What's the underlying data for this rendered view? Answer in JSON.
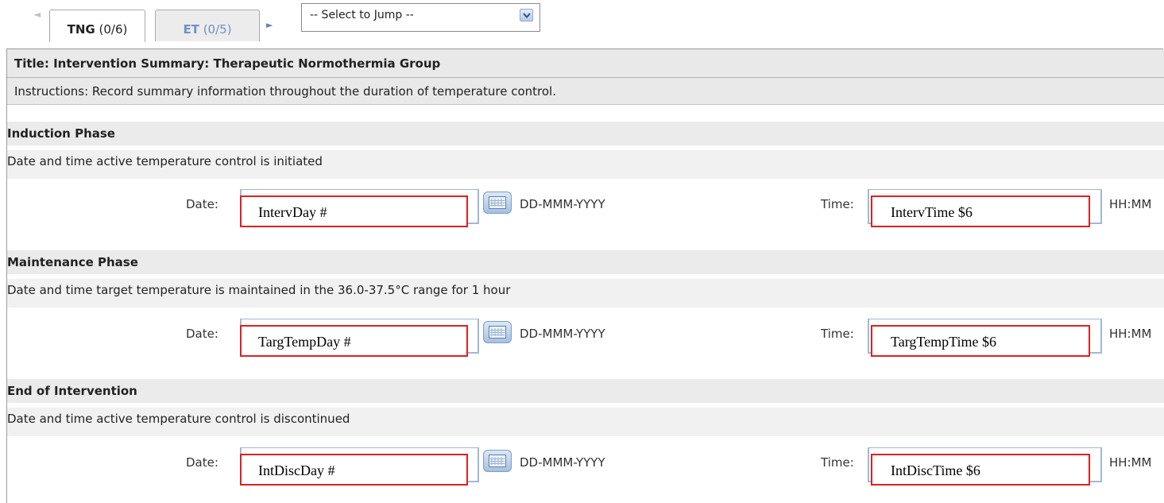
{
  "tabs": {
    "prev_arrow": "◄",
    "next_arrow": "►",
    "items": [
      {
        "code": "TNG",
        "count": "(0/6)"
      },
      {
        "code": "ET",
        "count": "(0/5)"
      }
    ],
    "jump_select": "-- Select to Jump --"
  },
  "form": {
    "title": "Title: Intervention Summary: Therapeutic Normothermia Group",
    "instructions": "Instructions: Record summary information throughout the duration of temperature control.",
    "date_label": "Date:",
    "time_label": "Time:",
    "date_format": "DD-MMM-YYYY",
    "time_format": "HH:MM",
    "sections": [
      {
        "header": "Induction Phase",
        "description": "Date and time active temperature control is initiated",
        "date_value": "IntervDay #",
        "time_value": "IntervTime $6"
      },
      {
        "header": "Maintenance Phase",
        "description": "Date and time target temperature is maintained in the 36.0-37.5°C range for 1 hour",
        "date_value": "TargTempDay #",
        "time_value": "TargTempTime $6"
      },
      {
        "header": "End of Intervention",
        "description": "Date and time active temperature control is discontinued",
        "date_value": "IntDiscDay #",
        "time_value": "IntDiscTime $6"
      }
    ]
  },
  "colors": {
    "annotation_border": "#e02020",
    "inactive_tab_text": "#6d93c3",
    "header_bg": "#e9e9e9"
  }
}
